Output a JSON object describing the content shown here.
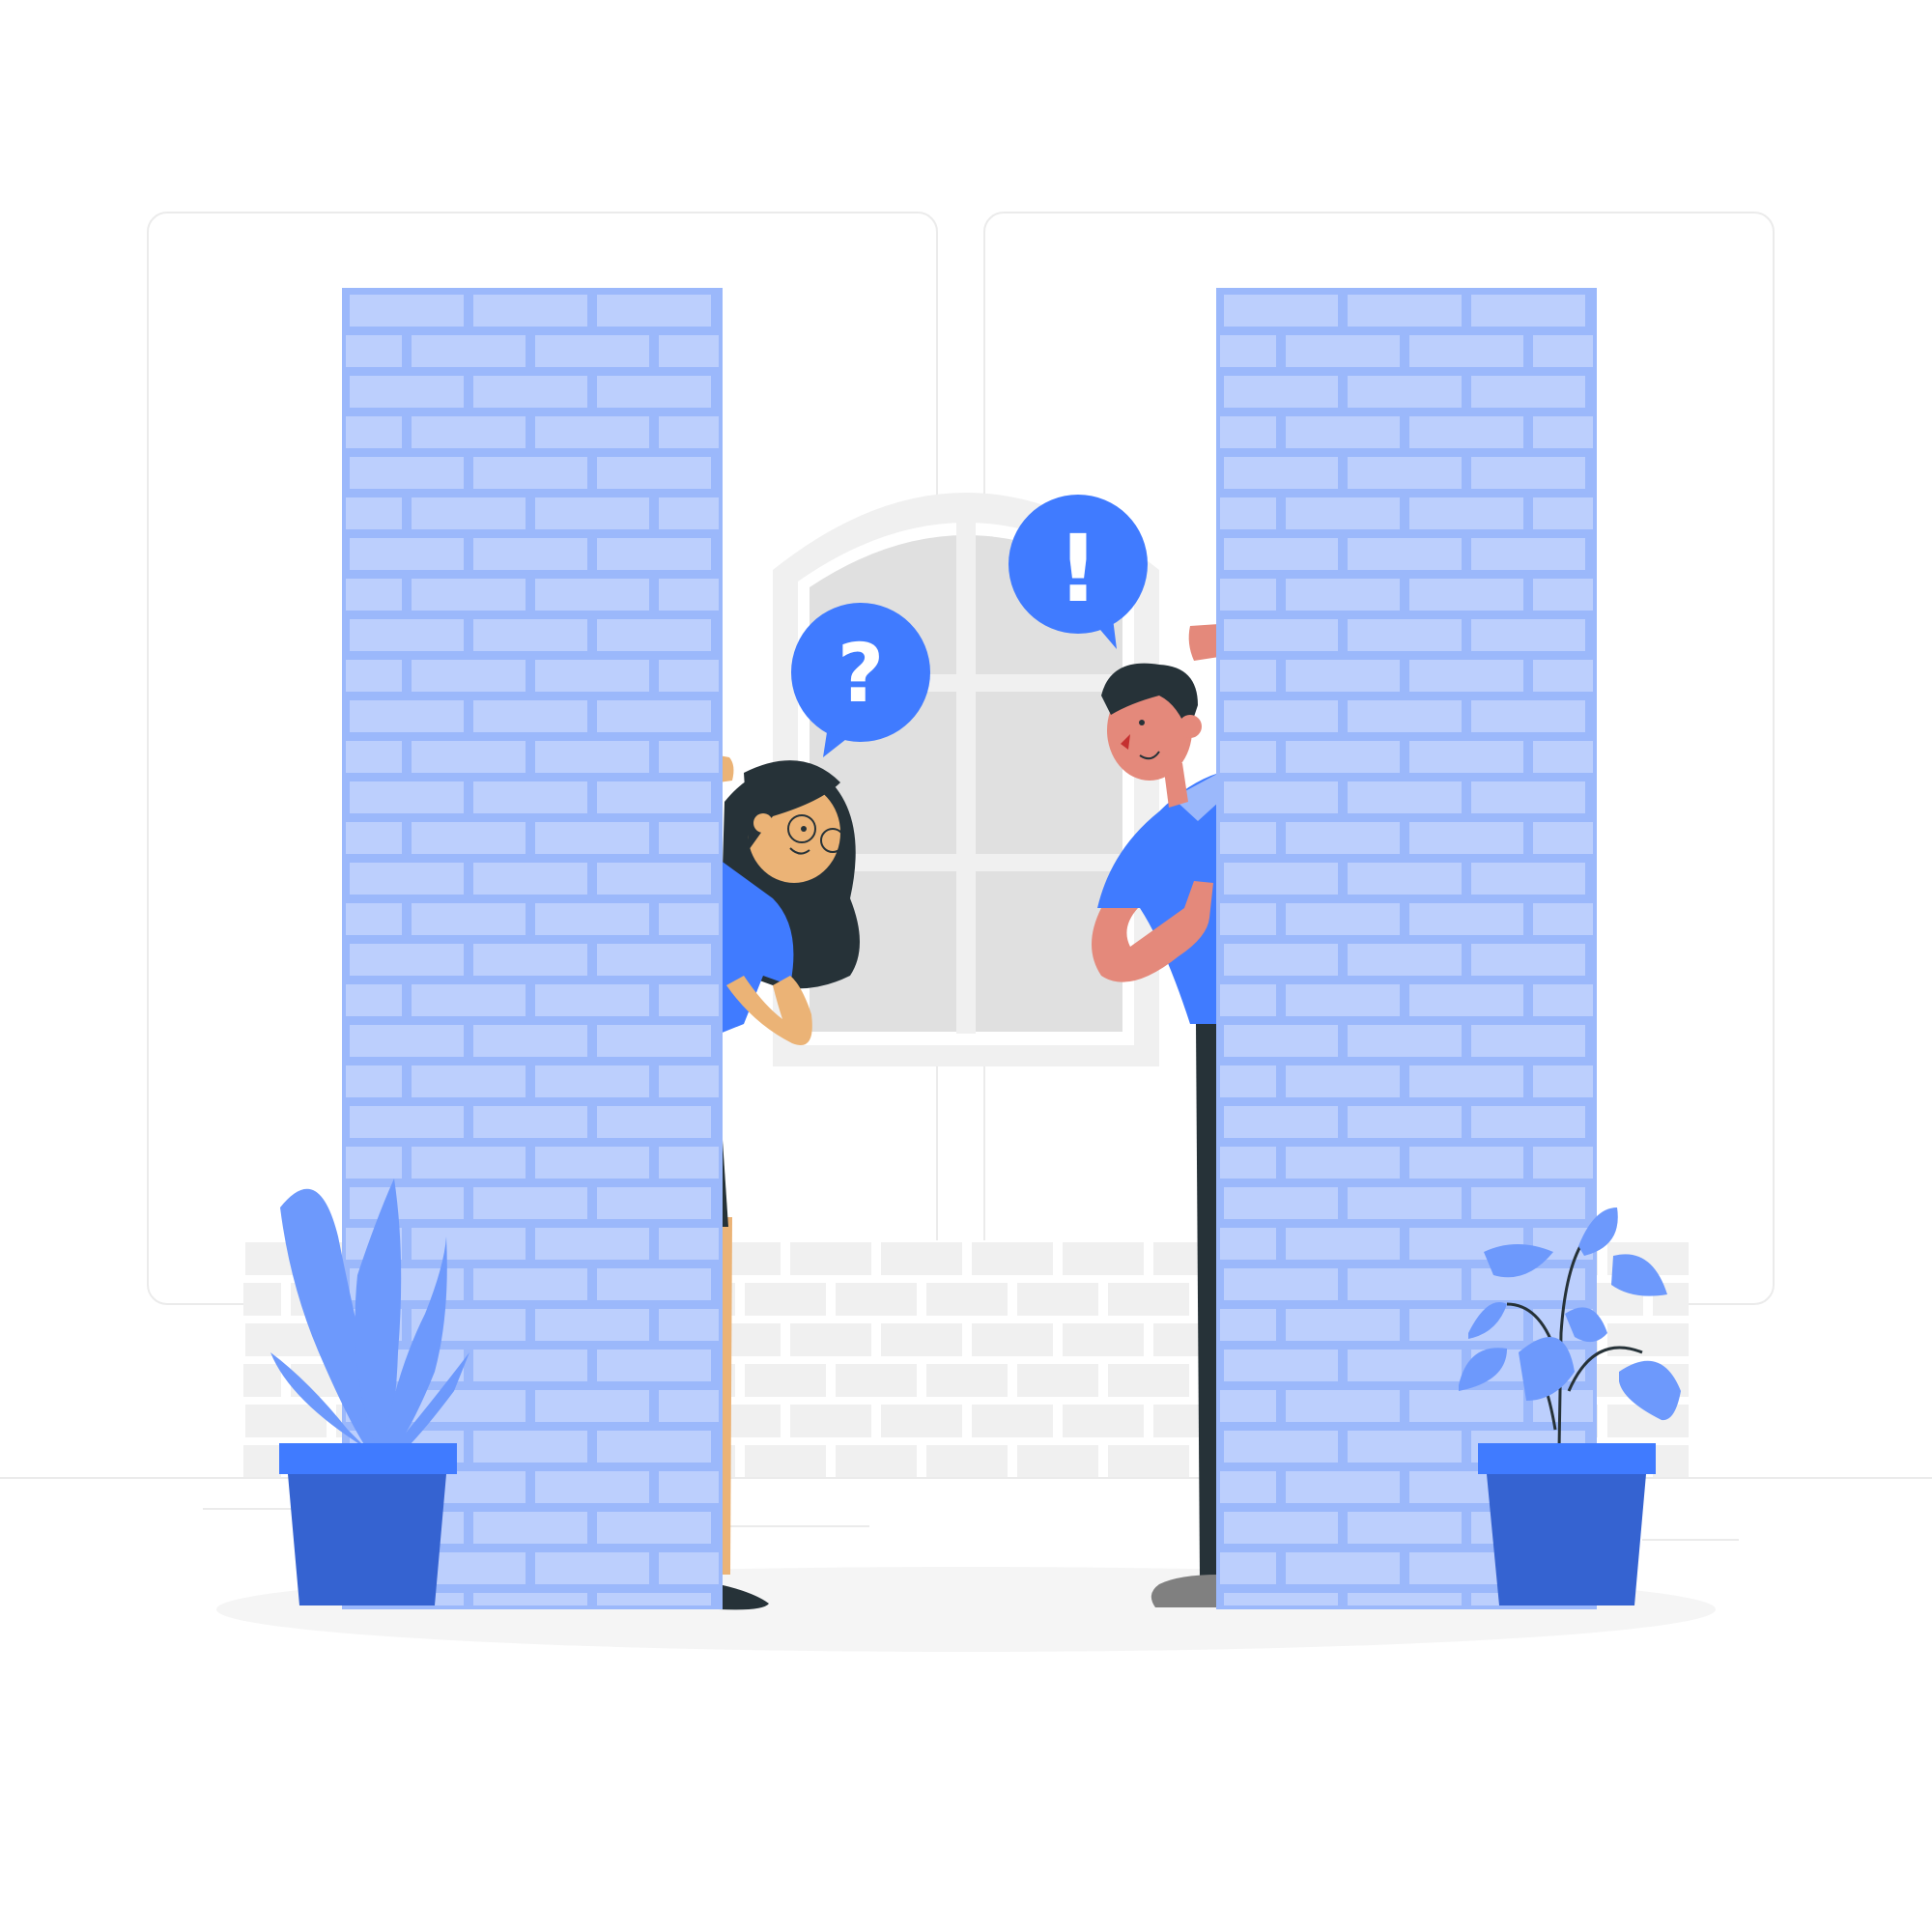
{
  "colors": {
    "background": "#ffffff",
    "panel_stroke": "#ebebeb",
    "brick_fill": "#bccffd",
    "brick_mortar": "#9bb8fb",
    "accent": "#407bff",
    "pot_dark": "#3563d1",
    "plant_leaf": "#6d99fc",
    "skin_woman": "#ebb376",
    "skin_man": "#e4897b",
    "hair": "#263238",
    "window_glass": "#e0e0e0",
    "window_frame": "#f0f0f0",
    "floor_shadow": "#f5f5f5",
    "back_brick": "#f0f0f0"
  },
  "speech_bubbles": {
    "question": "?",
    "exclamation": "!"
  },
  "icons": [
    "question-bubble-icon",
    "exclamation-bubble-icon",
    "plant-icon",
    "window-icon"
  ]
}
